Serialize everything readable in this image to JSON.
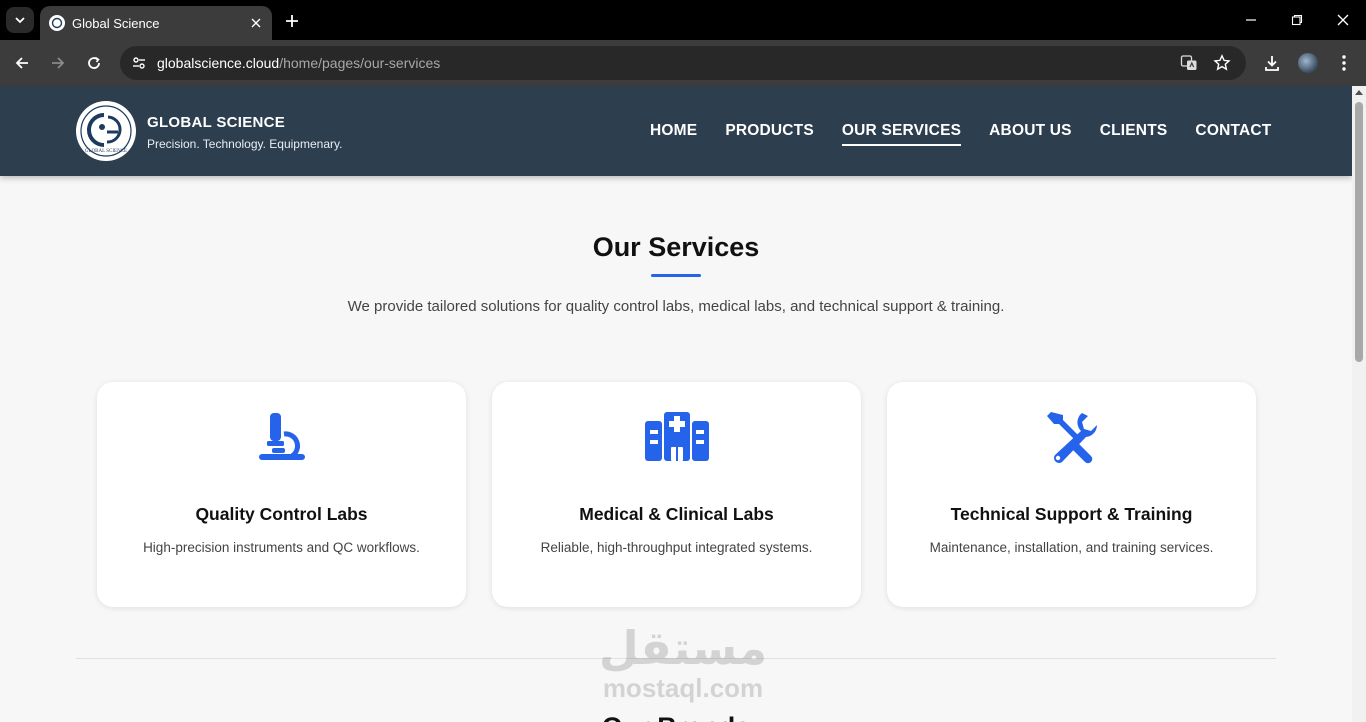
{
  "browser": {
    "tab_title": "Global Science",
    "url_domain": "globalscience.cloud",
    "url_path": "/home/pages/our-services"
  },
  "header": {
    "brand_name": "GLOBAL SCIENCE",
    "tagline": "Precision. Technology. Equipmenary.",
    "logo_text": "GLOBAL SCIENCE",
    "nav": [
      {
        "label": "HOME"
      },
      {
        "label": "PRODUCTS"
      },
      {
        "label": "OUR SERVICES"
      },
      {
        "label": "ABOUT US"
      },
      {
        "label": "CLIENTS"
      },
      {
        "label": "CONTACT"
      }
    ],
    "active_nav": "OUR SERVICES"
  },
  "services": {
    "title": "Our Services",
    "subtitle": "We provide tailored solutions for quality control labs, medical labs, and technical support & training.",
    "accent_color": "#2563eb",
    "cards": [
      {
        "icon": "microscope-icon",
        "title": "Quality Control Labs",
        "description": "High-precision instruments and QC workflows."
      },
      {
        "icon": "hospital-icon",
        "title": "Medical & Clinical Labs",
        "description": "Reliable, high-throughput integrated systems."
      },
      {
        "icon": "tools-icon",
        "title": "Technical Support & Training",
        "description": "Maintenance, installation, and training services."
      }
    ]
  },
  "next_section": {
    "title_partial": "Our Brands"
  },
  "watermark": {
    "arabic": "مستقل",
    "latin": "mostaql.com"
  },
  "colors": {
    "header_bg": "#2d3e4f",
    "page_bg": "#f7f7f7",
    "accent": "#2563eb"
  }
}
